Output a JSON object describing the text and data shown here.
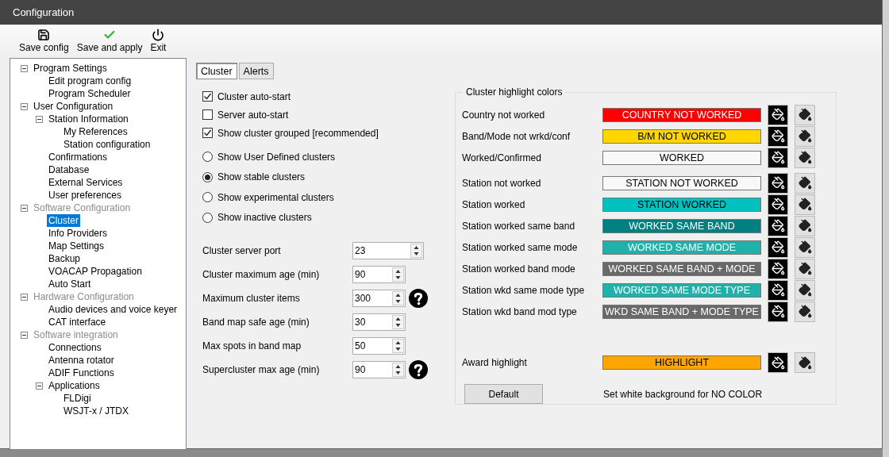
{
  "window": {
    "title": "Configuration"
  },
  "toolbar": [
    {
      "kind": "save",
      "label": "Save config"
    },
    {
      "kind": "apply",
      "label": "Save and apply"
    },
    {
      "kind": "exit",
      "label": "Exit"
    }
  ],
  "tree": [
    {
      "label": "Program Settings",
      "disabled": false,
      "selected": false,
      "expanded": true,
      "children": [
        {
          "label": "Edit program config",
          "disabled": false,
          "selected": false
        },
        {
          "label": "Program Scheduler",
          "disabled": false,
          "selected": false
        }
      ]
    },
    {
      "label": "User Configuration",
      "disabled": false,
      "selected": false,
      "expanded": true,
      "children": [
        {
          "label": "Station Information",
          "disabled": false,
          "selected": false,
          "expanded": true,
          "children": [
            {
              "label": "My References",
              "disabled": false,
              "selected": false
            },
            {
              "label": "Station configuration",
              "disabled": false,
              "selected": false
            }
          ]
        },
        {
          "label": "Confirmations",
          "disabled": false,
          "selected": false
        },
        {
          "label": "Database",
          "disabled": false,
          "selected": false
        },
        {
          "label": "External Services",
          "disabled": false,
          "selected": false
        },
        {
          "label": "User preferences",
          "disabled": false,
          "selected": false
        }
      ]
    },
    {
      "label": "Software Configuration",
      "disabled": true,
      "selected": false,
      "expanded": true,
      "children": [
        {
          "label": "Cluster",
          "disabled": false,
          "selected": true
        },
        {
          "label": "Info Providers",
          "disabled": false,
          "selected": false
        },
        {
          "label": "Map Settings",
          "disabled": false,
          "selected": false
        },
        {
          "label": "Backup",
          "disabled": false,
          "selected": false
        },
        {
          "label": "VOACAP Propagation",
          "disabled": false,
          "selected": false
        },
        {
          "label": "Auto Start",
          "disabled": false,
          "selected": false
        }
      ]
    },
    {
      "label": "Hardware Configuration",
      "disabled": true,
      "selected": false,
      "expanded": true,
      "children": [
        {
          "label": "Audio devices and voice keyer",
          "disabled": false,
          "selected": false
        },
        {
          "label": "CAT interface",
          "disabled": false,
          "selected": false
        }
      ]
    },
    {
      "label": "Software integration",
      "disabled": true,
      "selected": false,
      "expanded": true,
      "children": [
        {
          "label": "Connections",
          "disabled": false,
          "selected": false
        },
        {
          "label": "Antenna rotator",
          "disabled": false,
          "selected": false
        },
        {
          "label": "ADIF Functions",
          "disabled": false,
          "selected": false
        },
        {
          "label": "Applications",
          "disabled": false,
          "selected": false,
          "expanded": true,
          "children": [
            {
              "label": "FLDigi",
              "disabled": false,
              "selected": false
            },
            {
              "label": "WSJT-x / JTDX",
              "disabled": false,
              "selected": false
            }
          ]
        }
      ]
    }
  ],
  "tabs": [
    {
      "label": "Cluster",
      "selected": true
    },
    {
      "label": "Alerts",
      "selected": false
    }
  ],
  "checkboxes": [
    {
      "label": "Cluster auto-start",
      "checked": true
    },
    {
      "label": "Server auto-start",
      "checked": false
    },
    {
      "label": "Show cluster grouped [recommended]",
      "checked": true
    }
  ],
  "radios": [
    {
      "label": "Show User Defined clusters",
      "selected": false
    },
    {
      "label": "Show stable clusters",
      "selected": true
    },
    {
      "label": "Show experimental clusters",
      "selected": false
    },
    {
      "label": "Show inactive clusters",
      "selected": false
    }
  ],
  "spinners": [
    {
      "label": "Cluster server port",
      "value": "23",
      "wide": true,
      "help": false
    },
    {
      "label": "Cluster maximum age (min)",
      "value": "90",
      "wide": false,
      "help": false
    },
    {
      "label": "Maximum cluster items",
      "value": "300",
      "wide": false,
      "help": true
    },
    {
      "label": "Band map safe age (min)",
      "value": "30",
      "wide": false,
      "help": false
    },
    {
      "label": "Max spots in band map",
      "value": "50",
      "wide": false,
      "help": false
    },
    {
      "label": "Supercluster max age (min)",
      "value": "90",
      "wide": false,
      "help": true
    }
  ],
  "highlight_colors": {
    "title": "Cluster highlight colors",
    "sections": [
      {
        "rows": [
          {
            "label": "Country not worked",
            "sample": "COUNTRY NOT WORKED",
            "color": "#ff0000",
            "light_text": true
          },
          {
            "label": "Band/Mode not wrkd/conf",
            "sample": "B/M NOT WORKED",
            "color": "#ffd700",
            "light_text": false
          },
          {
            "label": "Worked/Confirmed",
            "sample": "WORKED",
            "color": "#f8f8f8",
            "light_text": false
          }
        ]
      },
      {
        "rows": [
          {
            "label": "Station not worked",
            "sample": "STATION NOT WORKED",
            "color": "#f8f8f8",
            "light_text": false
          },
          {
            "label": "Station worked",
            "sample": "STATION WORKED",
            "color": "#00c0c0",
            "light_text": false
          },
          {
            "label": "Station worked same band",
            "sample": "WORKED SAME BAND",
            "color": "#008080",
            "light_text": true
          },
          {
            "label": "Station worked same mode",
            "sample": "WORKED SAME MODE",
            "color": "#20b2aa",
            "light_text": true
          },
          {
            "label": "Station worked band mode",
            "sample": "WORKED SAME BAND + MODE",
            "color": "#696969",
            "light_text": true
          },
          {
            "label": "Station wkd same mode type",
            "sample": "WORKED SAME MODE TYPE",
            "color": "#20b2aa",
            "light_text": true
          },
          {
            "label": "Station wkd band mod type",
            "sample": "WKD SAME BAND + MODE TYPE",
            "color": "#696969",
            "light_text": true
          }
        ]
      }
    ],
    "award": {
      "label": "Award highlight",
      "sample": "HIGHLIGHT",
      "color": "#ffa500",
      "light_text": false
    },
    "default_button": "Default",
    "note": "Set white background for NO COLOR"
  }
}
